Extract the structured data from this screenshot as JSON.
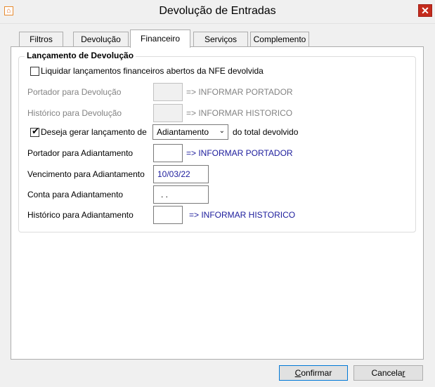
{
  "window": {
    "title": "Devolução de Entradas",
    "icon": "app-logo-icon",
    "close_glyph": "✕"
  },
  "tabs": [
    {
      "label": "Filtros",
      "active": false
    },
    {
      "label": "Devolução",
      "active": false
    },
    {
      "label": "Financeiro",
      "active": true
    },
    {
      "label": "Serviços",
      "active": false
    },
    {
      "label": "Complemento",
      "active": false
    }
  ],
  "group": {
    "title": "Lançamento de Devolução",
    "liquidar": {
      "label": "Liquidar lançamentos financeiros abertos da NFE devolvida",
      "checked": false
    },
    "portador_devolucao": {
      "label": "Portador para Devolução",
      "value": "",
      "hint": "=> INFORMAR PORTADOR"
    },
    "historico_devolucao": {
      "label": "Histórico para Devolução",
      "value": "",
      "hint": "=> INFORMAR HISTORICO"
    },
    "gerar": {
      "label": "Deseja gerar lançamento de",
      "checked": true,
      "check_glyph": "✔",
      "selected": "Adiantamento",
      "suffix": "do total devolvido"
    },
    "portador_adiantamento": {
      "label": "Portador para Adiantamento",
      "value": "",
      "hint": "=> INFORMAR PORTADOR"
    },
    "vencimento_adiantamento": {
      "label": "Vencimento para Adiantamento",
      "value": "10/03/22"
    },
    "conta_adiantamento": {
      "label": "Conta para Adiantamento",
      "value": ". ."
    },
    "historico_adiantamento": {
      "label": "Histórico para Adiantamento",
      "value": "",
      "hint": "=> INFORMAR HISTORICO"
    }
  },
  "buttons": {
    "confirm_first": "C",
    "confirm_rest": "onfirmar",
    "cancel_first": "Cancela",
    "cancel_u": "r"
  },
  "colors": {
    "accent": "#0078d7",
    "hint_blue": "#1c1c9c",
    "disabled_text": "#838383",
    "close": "#c42b1c"
  }
}
